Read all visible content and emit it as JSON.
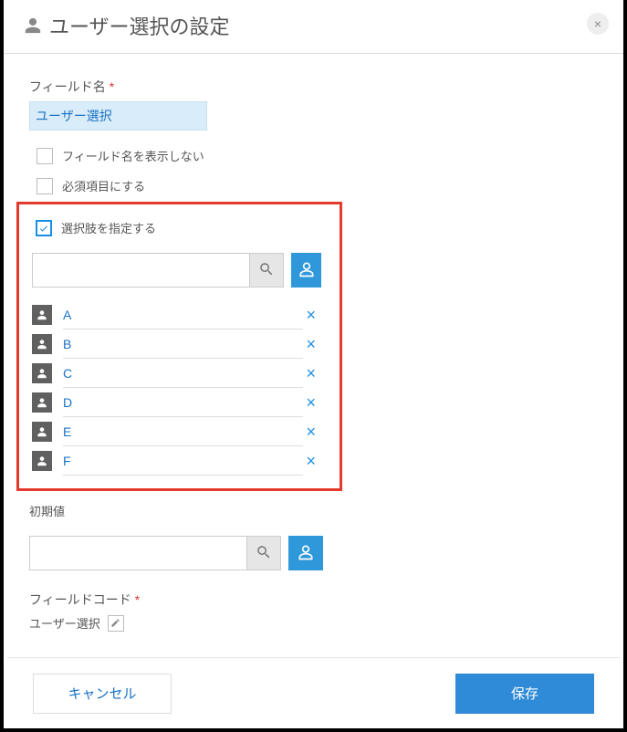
{
  "modal": {
    "title": "ユーザー選択の設定"
  },
  "field_name": {
    "label": "フィールド名",
    "value": "ユーザー選択"
  },
  "checkboxes": {
    "hide_field_name": {
      "label": "フィールド名を表示しない",
      "checked": false
    },
    "required": {
      "label": "必須項目にする",
      "checked": false
    },
    "specify_choices": {
      "label": "選択肢を指定する",
      "checked": true
    }
  },
  "search": {
    "placeholder": ""
  },
  "users": [
    {
      "name": "A"
    },
    {
      "name": "B"
    },
    {
      "name": "C"
    },
    {
      "name": "D"
    },
    {
      "name": "E"
    },
    {
      "name": "F"
    }
  ],
  "initial_value": {
    "label": "初期値",
    "value": ""
  },
  "field_code": {
    "label": "フィールドコード",
    "value": "ユーザー選択"
  },
  "buttons": {
    "cancel": "キャンセル",
    "save": "保存"
  }
}
